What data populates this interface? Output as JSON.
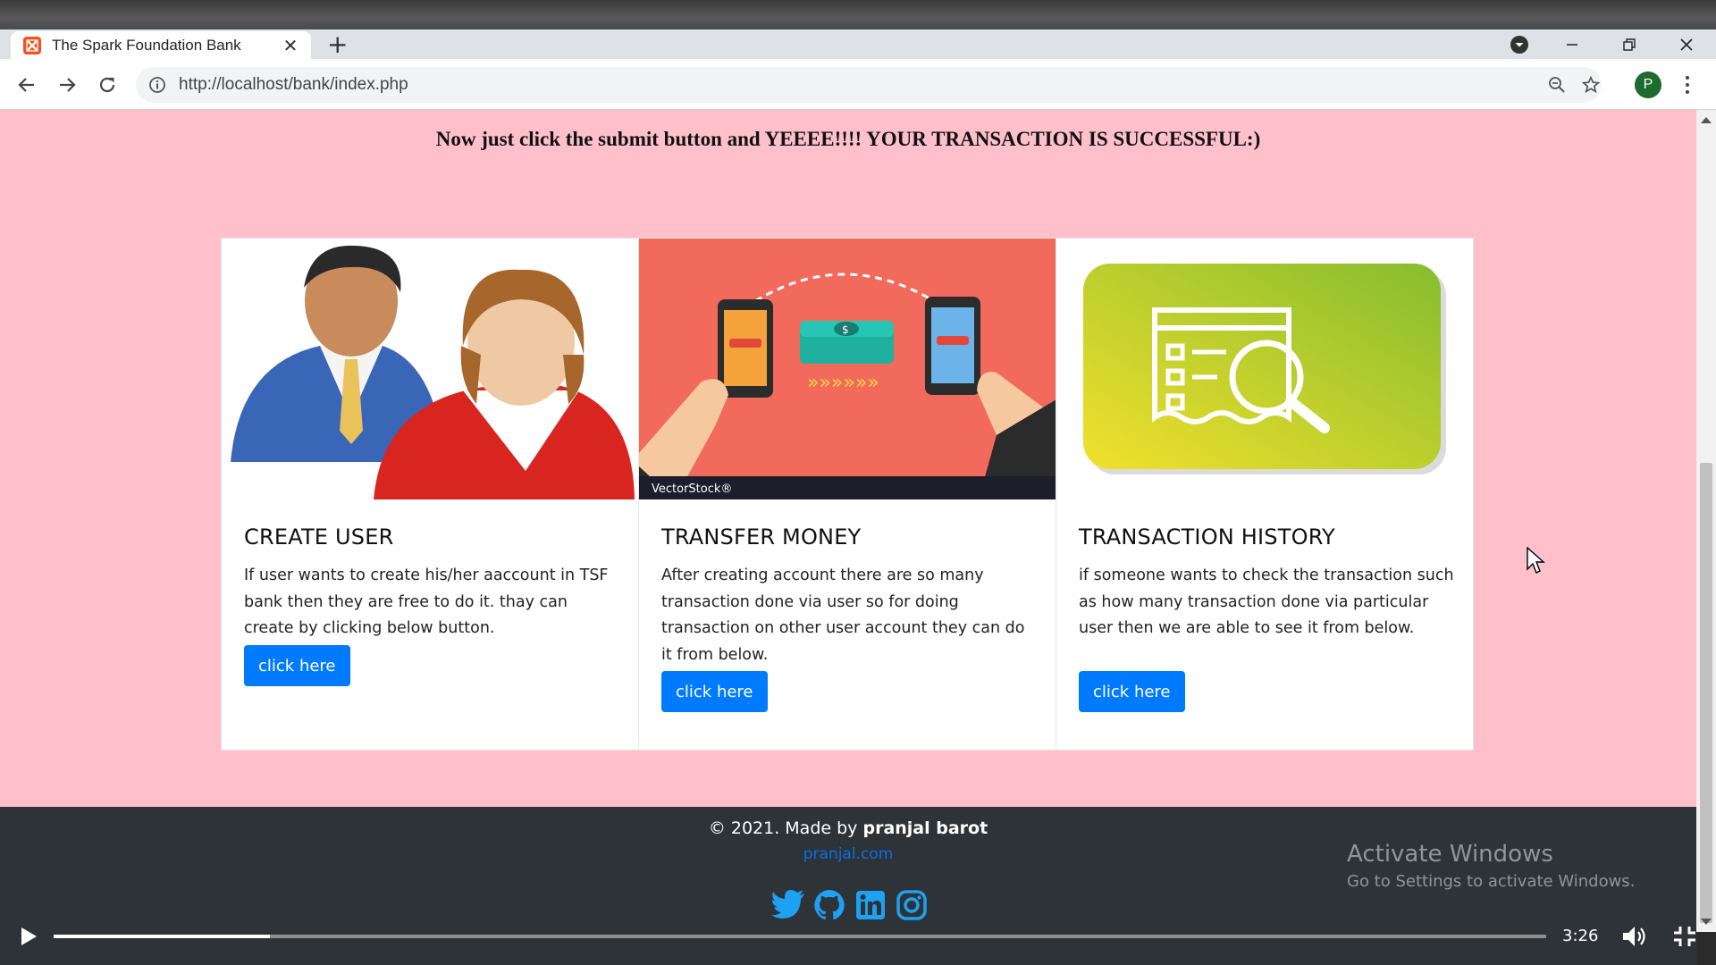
{
  "browser": {
    "tab_title": "The Spark Foundation Bank",
    "tab_close": "✕",
    "new_tab": "+",
    "url": "http://localhost/bank/index.php",
    "profile_initial": "P"
  },
  "page": {
    "headline": "Now just click the submit button and YEEEE!!!! YOUR TRANSACTION IS SUCCESSFUL:)",
    "background": "#ffc0cb",
    "cards": [
      {
        "title": "CREATE USER",
        "text": "If user wants to create his/her aaccount in TSF bank then they are free to do it. thay can create by clicking below button.",
        "button": "click here",
        "image": "users-illustration"
      },
      {
        "title": "TRANSFER MONEY",
        "text": "After creating account there are so many transaction done via user so for doing transaction on other user account they can do it from below.",
        "button": "click here",
        "image": "money-transfer-illustration",
        "watermark": "VectorStock®"
      },
      {
        "title": "TRANSACTION HISTORY",
        "text": "if someone wants to check the transaction such as how many transaction done via particular user then we are able to see it from below.",
        "button": "click here",
        "image": "receipt-search-illustration"
      }
    ],
    "button_color": "#007bff"
  },
  "footer": {
    "copyright_prefix": "© 2021. Made by ",
    "author": "pranjal barot",
    "link": "pranjal.com",
    "social_icons": [
      "twitter-icon",
      "github-icon",
      "linkedin-icon",
      "instagram-icon"
    ]
  },
  "windows_watermark": {
    "line1": "Activate Windows",
    "line2": "Go to Settings to activate Windows."
  },
  "video": {
    "time": "3:26",
    "progress": 0.145
  }
}
